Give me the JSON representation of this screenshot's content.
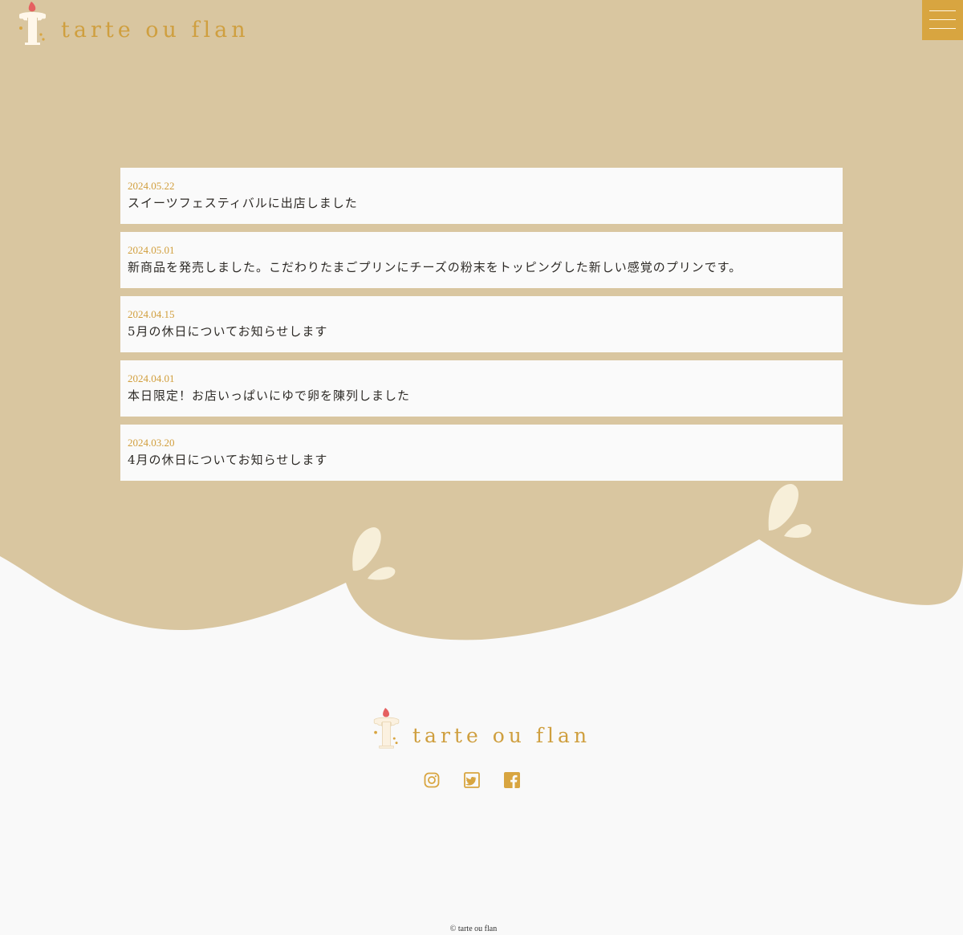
{
  "brand": {
    "name": "tarte ou flan"
  },
  "header": {
    "menu_label": ""
  },
  "news": [
    {
      "date": "2024.05.22",
      "title": "スイーツフェスティバルに出店しました"
    },
    {
      "date": "2024.05.01",
      "title": "新商品を発売しました。こだわりたまごプリンにチーズの粉末をトッピングした新しい感覚のプリンです。"
    },
    {
      "date": "2024.04.15",
      "title": "5月の休日についてお知らせします"
    },
    {
      "date": "2024.04.01",
      "title": "本日限定！お店いっぱいにゆで卵を陳列しました"
    },
    {
      "date": "2024.03.20",
      "title": "4月の休日についてお知らせします"
    }
  ],
  "footer": {
    "social": [
      {
        "icon": "instagram-icon"
      },
      {
        "icon": "twitter-icon"
      },
      {
        "icon": "facebook-icon"
      }
    ],
    "copyright": "© tarte ou flan"
  },
  "colors": {
    "background_top": "#d9c6a0",
    "background_bottom": "#f9f9f9",
    "accent": "#d8a540",
    "wordmark": "#cf9f3f",
    "strawberry": "#e56060"
  }
}
